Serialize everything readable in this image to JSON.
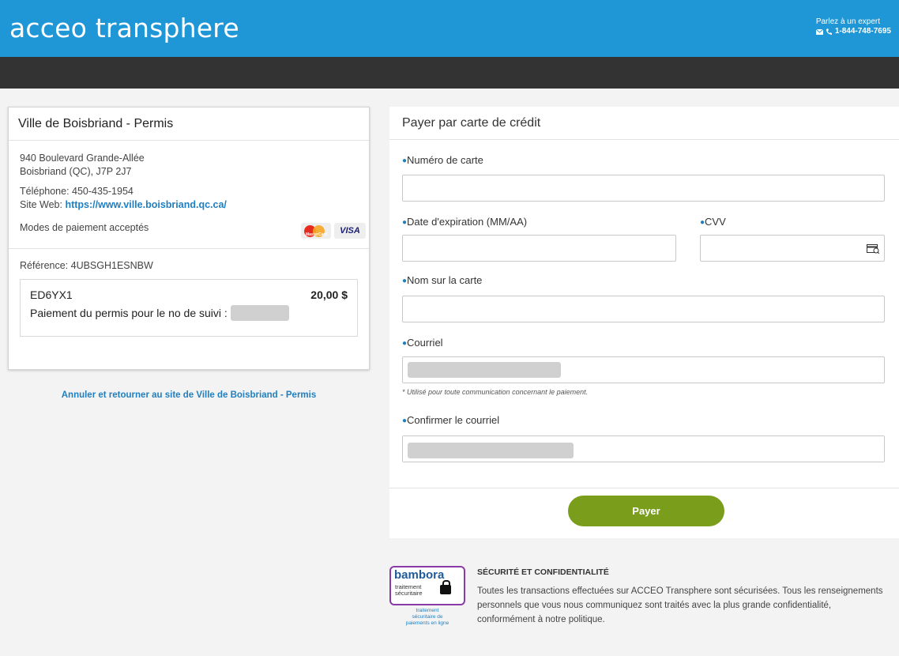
{
  "header": {
    "logo": "acceo transphere",
    "expert_label": "Parlez à un expert",
    "phone": "1-844-748-7695",
    "email_icon": "envelope-icon",
    "phone_icon": "phone-icon"
  },
  "merchant": {
    "title": "Ville de Boisbriand - Permis",
    "address_line1": "940 Boulevard Grande-Allée",
    "address_line2": "Boisbriand (QC), J7P 2J7",
    "phone": "Téléphone: 450-435-1954",
    "website_label": "Site Web:",
    "website_url": "https://www.ville.boisbriand.qc.ca/",
    "payment_modes_label": "Modes de paiement acceptés",
    "cards": [
      "MasterCard",
      "VISA"
    ],
    "reference": "Référence: 4UBSGH1ESNBW",
    "item": {
      "code": "ED6YX1",
      "amount": "20,00 $",
      "description": "Paiement du permis pour le no de suivi :"
    },
    "cancel_link": "Annuler et retourner au site de Ville de Boisbriand - Permis"
  },
  "form": {
    "title": "Payer par carte de crédit",
    "card_number_label": "Numéro de carte",
    "expiry_label": "Date d'expiration (MM/AA)",
    "cvv_label": "CVV",
    "cvv_icon": "card-cvv-icon",
    "name_label": "Nom sur la carte",
    "email_label": "Courriel",
    "email_note": "* Utilisé pour toute communication concernant le paiement.",
    "confirm_email_label": "Confirmer le courriel",
    "pay_button": "Payer"
  },
  "security": {
    "badge_name": "bambora",
    "badge_sub1": "traitement",
    "badge_sub2": "sécuritaire",
    "badge_caption1": "traitement",
    "badge_caption2": "sécuritaire de",
    "badge_caption3": "paiements en ligne",
    "heading": "SÉCURITÉ ET CONFIDENTIALITÉ",
    "text": "Toutes les transactions effectuées sur ACCEO Transphere sont sécurisées. Tous les renseignements personnels que vous nous communiquez sont traités avec la plus grande confidentialité, conformément à notre politique."
  },
  "colors": {
    "brand_blue": "#1f96d6",
    "dark_bar": "#333333",
    "pay_green": "#7a9d1c",
    "link_blue": "#1f7fc0"
  }
}
